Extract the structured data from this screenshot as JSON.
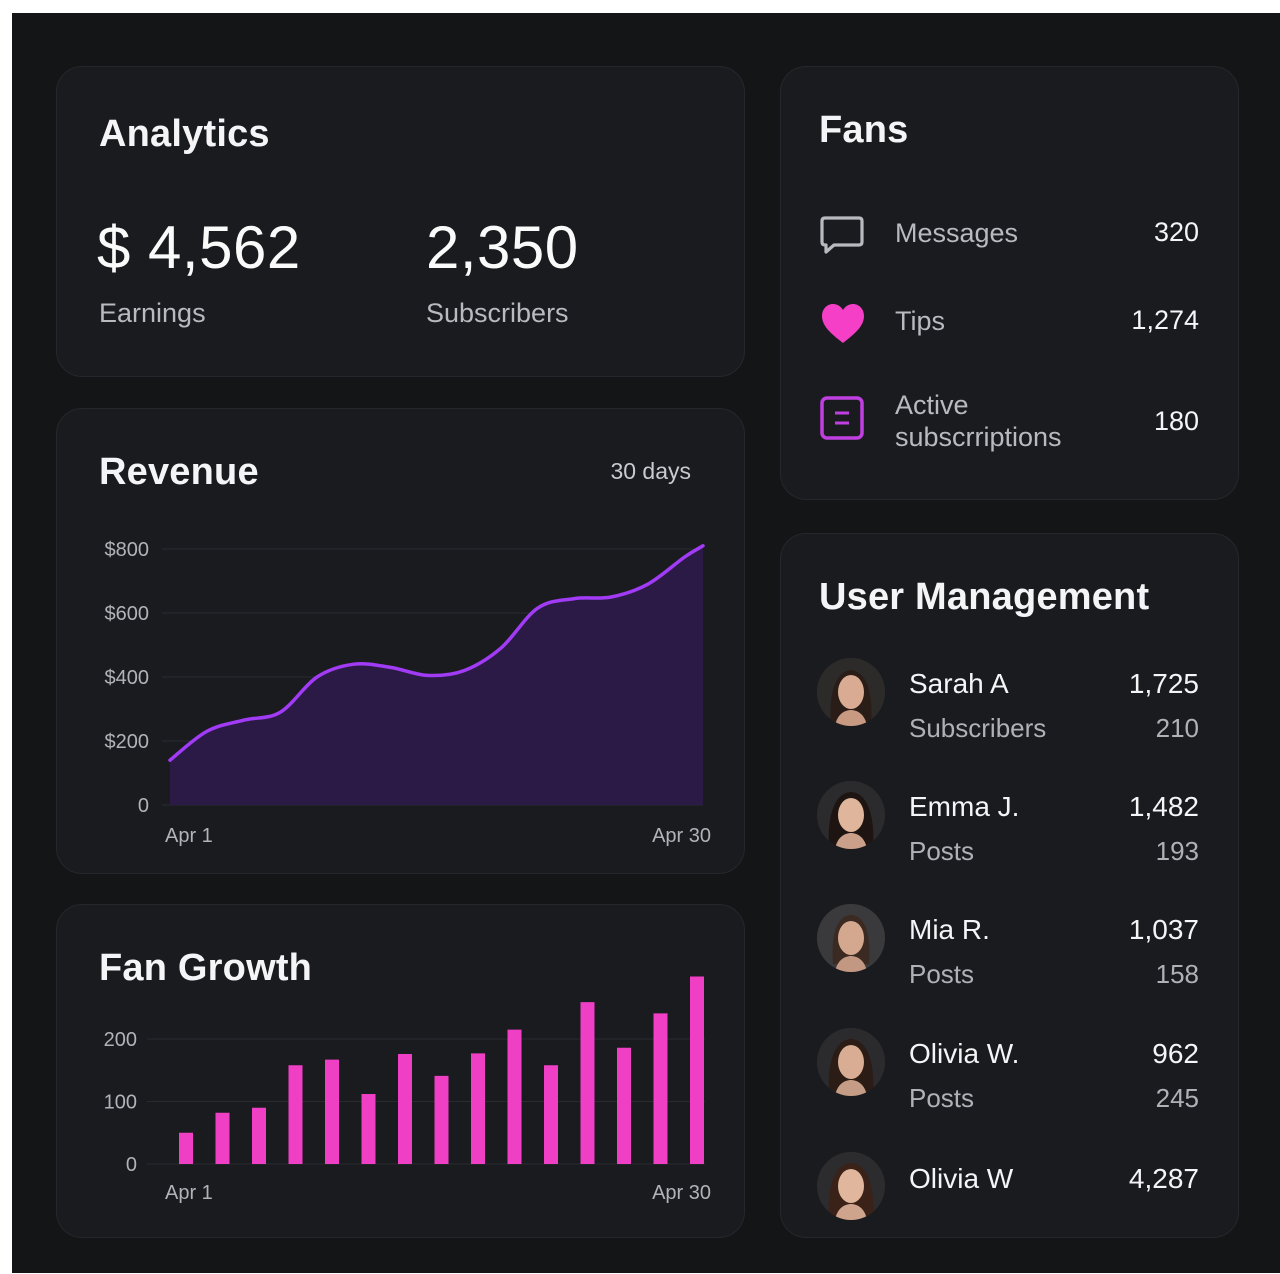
{
  "analytics": {
    "title": "Analytics",
    "earnings_value": "$ 4,562",
    "earnings_label": "Earnings",
    "subscribers_value": "2,350",
    "subscribers_label": "Subscribers"
  },
  "revenue": {
    "title": "Revenue",
    "period": "30 days",
    "chart_data": {
      "type": "area",
      "x_start_label": "Apr 1",
      "x_end_label": "Apr 30",
      "y_ticks": [
        "$800",
        "$600",
        "$400",
        "$200",
        "0"
      ],
      "ylim": [
        0,
        800
      ],
      "x": [
        1,
        3,
        5,
        7,
        9,
        11,
        13,
        15,
        17,
        19,
        21,
        23,
        25,
        27,
        29,
        30
      ],
      "values": [
        140,
        230,
        265,
        290,
        400,
        440,
        430,
        405,
        420,
        490,
        615,
        645,
        650,
        690,
        775,
        810
      ],
      "color": "#a13bf5",
      "fill": "#2b1a45"
    }
  },
  "fan_growth": {
    "title": "Fan Growth",
    "chart_data": {
      "type": "bar",
      "x_start_label": "Apr 1",
      "x_end_label": "Apr 30",
      "y_ticks": [
        "200",
        "100",
        "0"
      ],
      "ylim": [
        0,
        250
      ],
      "values": [
        50,
        82,
        90,
        158,
        167,
        112,
        176,
        141,
        177,
        215,
        158,
        259,
        186,
        241,
        300
      ],
      "color": "#ef3fc4"
    }
  },
  "fans": {
    "title": "Fans",
    "rows": [
      {
        "label": "Messages",
        "value": "320",
        "icon": "message-icon"
      },
      {
        "label": "Tips",
        "value": "1,274",
        "icon": "heart-icon"
      },
      {
        "label": "Active subscrriptions",
        "label_line1": "Active",
        "label_line2": "subscrriptions",
        "value": "180",
        "icon": "subscription-icon"
      }
    ],
    "colors": {
      "heart": "#f43fc6",
      "subscription": "#c03fe0",
      "message": "#b9bac0"
    }
  },
  "users": {
    "title": "User Management",
    "list": [
      {
        "name": "Sarah A",
        "value1": "1,725",
        "sub": "Subscribers",
        "value2": "210"
      },
      {
        "name": "Emma J.",
        "value1": "1,482",
        "sub": "Posts",
        "value2": "193"
      },
      {
        "name": "Mia R.",
        "value1": "1,037",
        "sub": "Posts",
        "value2": "158"
      },
      {
        "name": "Olivia W.",
        "value1": "962",
        "sub": "Posts",
        "value2": "245"
      },
      {
        "name": "Olivia W",
        "value1": "4,287"
      }
    ]
  }
}
